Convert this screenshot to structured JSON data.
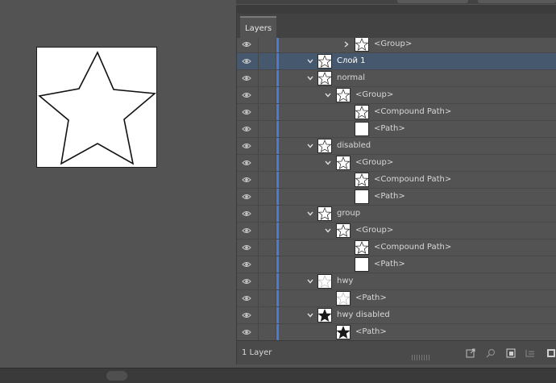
{
  "panel": {
    "tab_label": "Layers",
    "footer_count": "1 Layer"
  },
  "layers": [
    {
      "label": "<Group>",
      "depth": 3,
      "chevron": "right",
      "thumb": "star-outline",
      "selected": false
    },
    {
      "label": "Слой 1",
      "depth": 0,
      "chevron": "down",
      "thumb": "star-outline",
      "selected": true
    },
    {
      "label": "normal",
      "depth": 1,
      "chevron": "down",
      "thumb": "star-outline",
      "selected": false
    },
    {
      "label": "<Group>",
      "depth": 2,
      "chevron": "down",
      "thumb": "star-outline",
      "selected": false
    },
    {
      "label": "<Compound Path>",
      "depth": 3,
      "chevron": "none",
      "thumb": "star-outline",
      "selected": false
    },
    {
      "label": "<Path>",
      "depth": 3,
      "chevron": "none",
      "thumb": "blank",
      "selected": false
    },
    {
      "label": "disabled",
      "depth": 1,
      "chevron": "down",
      "thumb": "star-outline",
      "selected": false
    },
    {
      "label": "<Group>",
      "depth": 2,
      "chevron": "down",
      "thumb": "star-outline",
      "selected": false
    },
    {
      "label": "<Compound Path>",
      "depth": 3,
      "chevron": "none",
      "thumb": "star-outline",
      "selected": false
    },
    {
      "label": "<Path>",
      "depth": 3,
      "chevron": "none",
      "thumb": "blank",
      "selected": false
    },
    {
      "label": "group",
      "depth": 1,
      "chevron": "down",
      "thumb": "star-outline",
      "selected": false
    },
    {
      "label": "<Group>",
      "depth": 2,
      "chevron": "down",
      "thumb": "star-outline",
      "selected": false
    },
    {
      "label": "<Compound Path>",
      "depth": 3,
      "chevron": "none",
      "thumb": "star-outline",
      "selected": false
    },
    {
      "label": "<Path>",
      "depth": 3,
      "chevron": "none",
      "thumb": "blank",
      "selected": false
    },
    {
      "label": "hwy",
      "depth": 1,
      "chevron": "down",
      "thumb": "star-faint",
      "selected": false
    },
    {
      "label": "<Path>",
      "depth": 2,
      "chevron": "none",
      "thumb": "star-faint",
      "selected": false
    },
    {
      "label": "hwy disabled",
      "depth": 1,
      "chevron": "down",
      "thumb": "star-filled",
      "selected": false
    },
    {
      "label": "<Path>",
      "depth": 2,
      "chevron": "none",
      "thumb": "star-filled",
      "selected": false
    }
  ],
  "colors": {
    "layer_color": "#4a7bd6",
    "selected_row": "#46586e"
  }
}
